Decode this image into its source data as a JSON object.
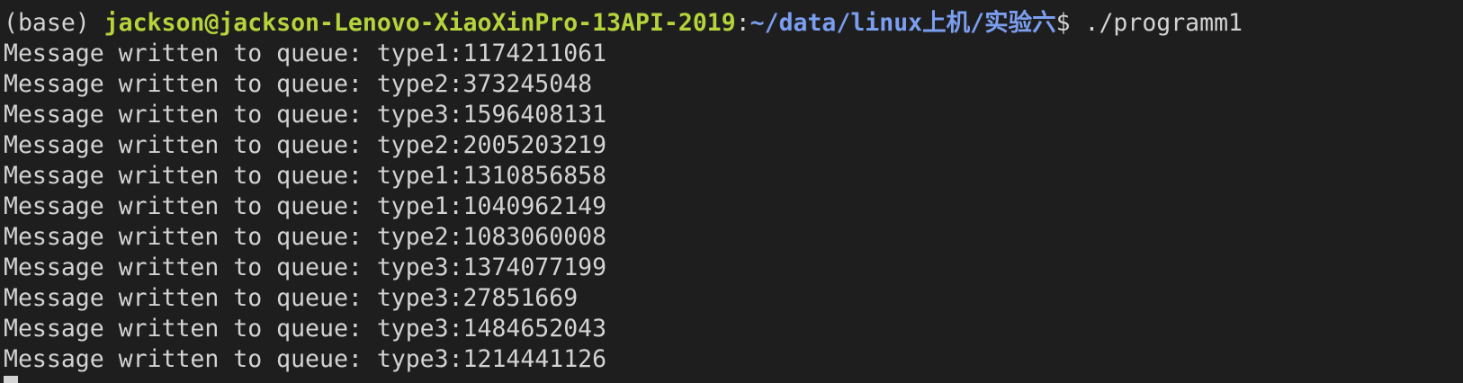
{
  "terminal": {
    "prompt": {
      "env": "(base) ",
      "user_host": "jackson@jackson-Lenovo-XiaoXinPro-13API-2019",
      "separator": ":",
      "path": "~/data/linux上机/实验六",
      "dollar": "$ ",
      "command": "./programm1"
    },
    "output": [
      "Message written to queue: type1:1174211061",
      "Message written to queue: type2:373245048",
      "Message written to queue: type3:1596408131",
      "Message written to queue: type2:2005203219",
      "Message written to queue: type1:1310856858",
      "Message written to queue: type1:1040962149",
      "Message written to queue: type2:1083060008",
      "Message written to queue: type3:1374077199",
      "Message written to queue: type3:27851669",
      "Message written to queue: type3:1484652043",
      "Message written to queue: type3:1214441126"
    ],
    "colors": {
      "background": "#1e1e1e",
      "text": "#d3d3d3",
      "user_host": "#b5d33b",
      "path": "#7b9ef0"
    }
  }
}
